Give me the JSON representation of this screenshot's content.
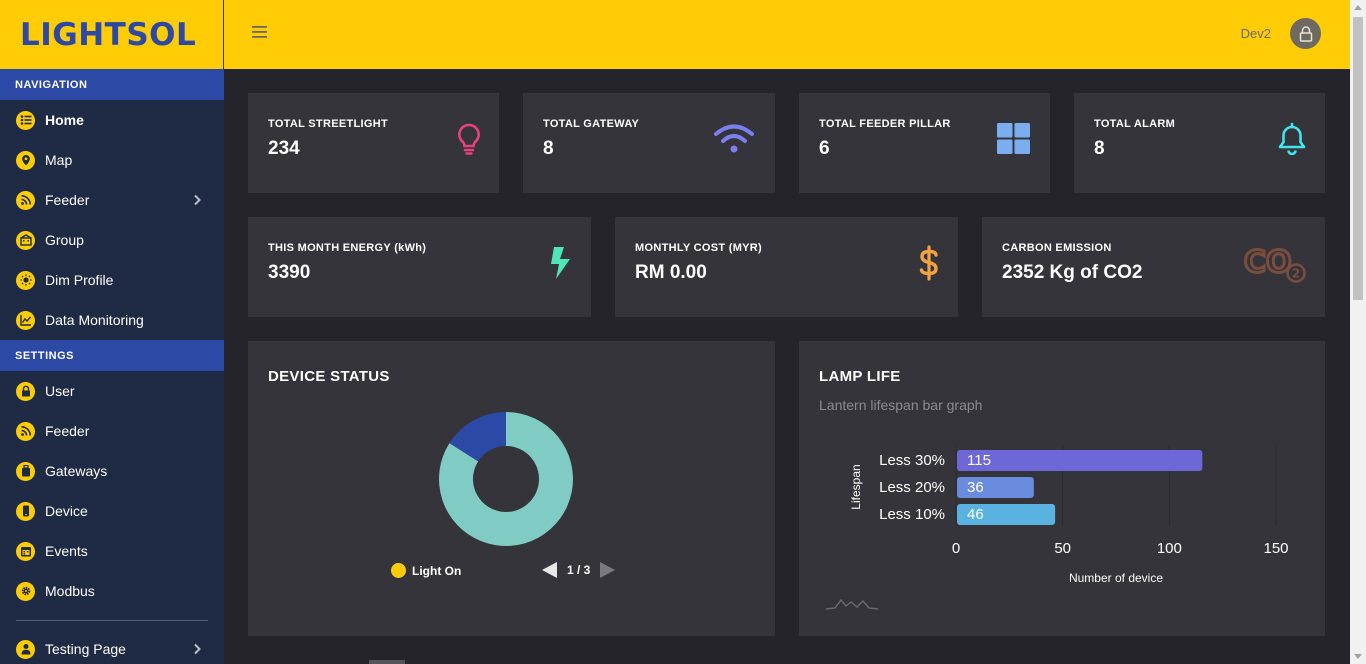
{
  "brand": {
    "logo": "LIGHTSOL"
  },
  "sidebar": {
    "navigation_header": "NAVIGATION",
    "navigation_items": [
      {
        "label": "Home",
        "icon": "list-icon"
      },
      {
        "label": "Map",
        "icon": "location-pin-icon"
      },
      {
        "label": "Feeder",
        "icon": "rss-icon"
      },
      {
        "label": "Group",
        "icon": "building-icon"
      },
      {
        "label": "Dim Profile",
        "icon": "sun-icon"
      },
      {
        "label": "Data Monitoring",
        "icon": "chart-line-icon"
      }
    ],
    "settings_header": "SETTINGS",
    "settings_items": [
      {
        "label": "User",
        "icon": "lock-icon"
      },
      {
        "label": "Feeder",
        "icon": "rss-icon"
      },
      {
        "label": "Gateways",
        "icon": "box-icon"
      },
      {
        "label": "Device",
        "icon": "mobile-icon"
      },
      {
        "label": "Events",
        "icon": "calendar-icon"
      },
      {
        "label": "Modbus",
        "icon": "gear-icon"
      }
    ],
    "extra_items": [
      {
        "label": "Testing Page",
        "icon": "user-icon"
      }
    ]
  },
  "topbar": {
    "user_name": "Dev2"
  },
  "stats_row1": [
    {
      "label": "TOTAL STREETLIGHT",
      "value": "234",
      "icon": "lightbulb-icon",
      "color": "#e8417f"
    },
    {
      "label": "TOTAL GATEWAY",
      "value": "8",
      "icon": "wifi-icon",
      "color": "#7b7ff0"
    },
    {
      "label": "TOTAL FEEDER PILLAR",
      "value": "6",
      "icon": "grid-icon",
      "color": "#7aaeee"
    },
    {
      "label": "TOTAL ALARM",
      "value": "8",
      "icon": "bell-icon",
      "color": "#3fe6ef"
    }
  ],
  "stats_row2": [
    {
      "label": "THIS MONTH ENERGY (kWh)",
      "value": "3390",
      "icon": "bolt-icon",
      "color": "#4fe5b6"
    },
    {
      "label": "MONTHLY COST (MYR)",
      "value": "RM 0.00",
      "icon": "dollar-icon",
      "color": "#f2a33f"
    },
    {
      "label": "CARBON EMISSION",
      "value": "2352 Kg of CO2",
      "icon": "co2-icon",
      "icon_text": "CO",
      "icon_sub": "2",
      "color": "#7a4e3e"
    }
  ],
  "device_status": {
    "title": "DEVICE STATUS",
    "legend_label": "Light On",
    "pager": "1 / 3"
  },
  "lamp_life": {
    "title": "LAMP LIFE",
    "subtitle": "Lantern lifespan bar graph"
  },
  "chart_data": [
    {
      "type": "pie",
      "variant": "donut",
      "slices": [
        {
          "label": "Light On",
          "value": 84,
          "color": "#80cbc4"
        },
        {
          "value": 16,
          "color": "#2d49a6"
        }
      ]
    },
    {
      "type": "bar",
      "orientation": "horizontal",
      "categories": [
        "Less 30%",
        "Less 20%",
        "Less 10%"
      ],
      "values": [
        115,
        36,
        46
      ],
      "colors": [
        "#6e67d8",
        "#6a8cdf",
        "#5ab2e0"
      ],
      "xlabel": "Number of device",
      "ylabel": "Lifespan",
      "xlim": [
        0,
        150
      ],
      "xticks": [
        0,
        50,
        100,
        150
      ],
      "grid": true
    }
  ]
}
